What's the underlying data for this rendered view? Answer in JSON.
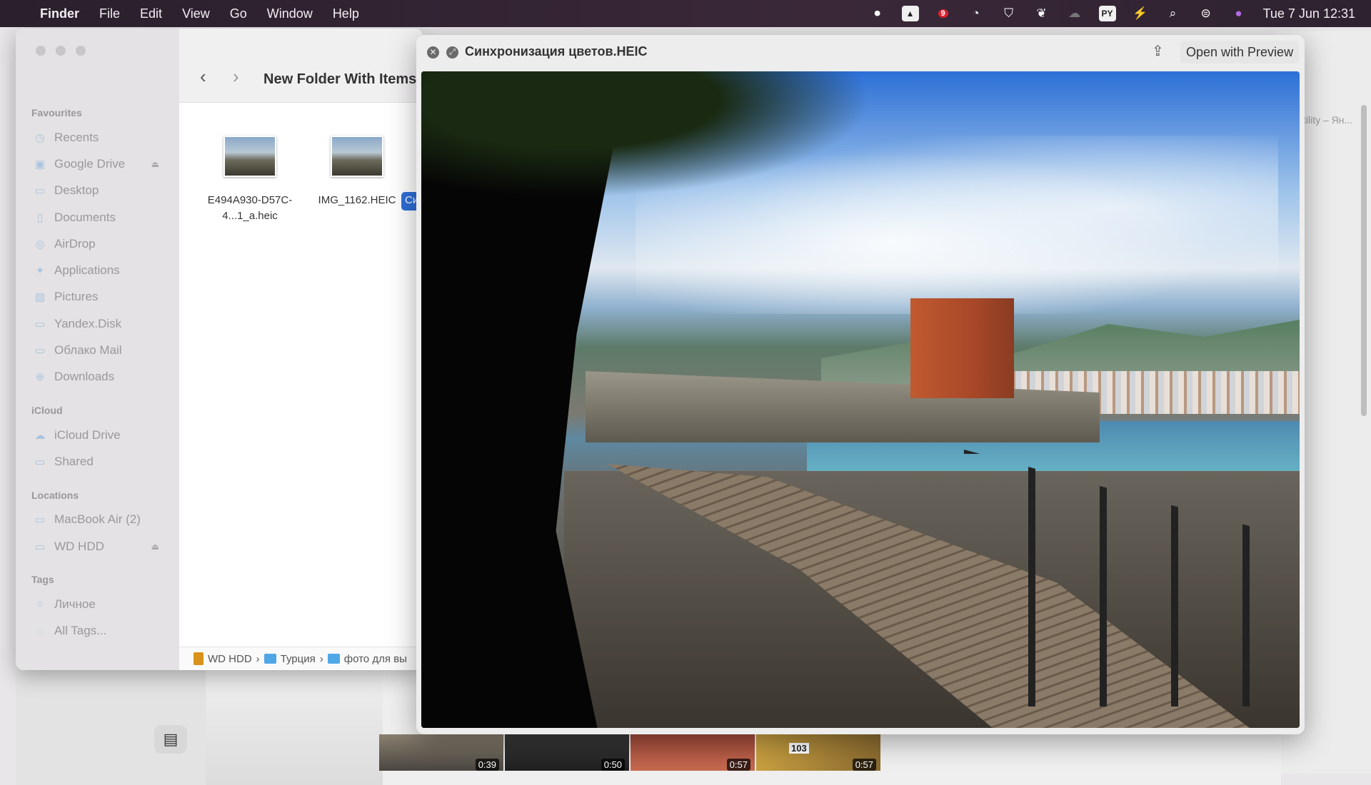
{
  "menubar": {
    "app": "Finder",
    "items": [
      "File",
      "Edit",
      "View",
      "Go",
      "Window",
      "Help"
    ],
    "clock": "Tue 7 Jun  12:31",
    "badge": "9",
    "py_label": "PY"
  },
  "finder": {
    "title": "New Folder With Items",
    "sidebar": {
      "sections": [
        {
          "title": "Favourites",
          "items": [
            "Recents",
            "Google Drive",
            "Desktop",
            "Documents",
            "AirDrop",
            "Applications",
            "Pictures",
            "Yandex.Disk",
            "Облако Mail",
            "Downloads"
          ]
        },
        {
          "title": "iCloud",
          "items": [
            "iCloud Drive",
            "Shared"
          ]
        },
        {
          "title": "Locations",
          "items": [
            "MacBook Air (2)",
            "WD HDD"
          ]
        },
        {
          "title": "Tags",
          "items": [
            "Личное",
            "All Tags..."
          ]
        }
      ]
    },
    "files": [
      {
        "name": "E494A930-D57C-4...1_a.heic"
      },
      {
        "name": "IMG_1162.HEIC"
      }
    ],
    "selected_file_partial": "Си",
    "path": [
      "WD HDD",
      "Турция",
      "фото для вы"
    ]
  },
  "quicklook": {
    "title": "Синхронизация цветов.HEIC",
    "open_button": "Open with Preview"
  },
  "background": {
    "window_title": "tility – Ян...",
    "video_durations": [
      "0:39",
      "0:50",
      "0:57",
      "0:57"
    ],
    "thumb_number": "103"
  }
}
